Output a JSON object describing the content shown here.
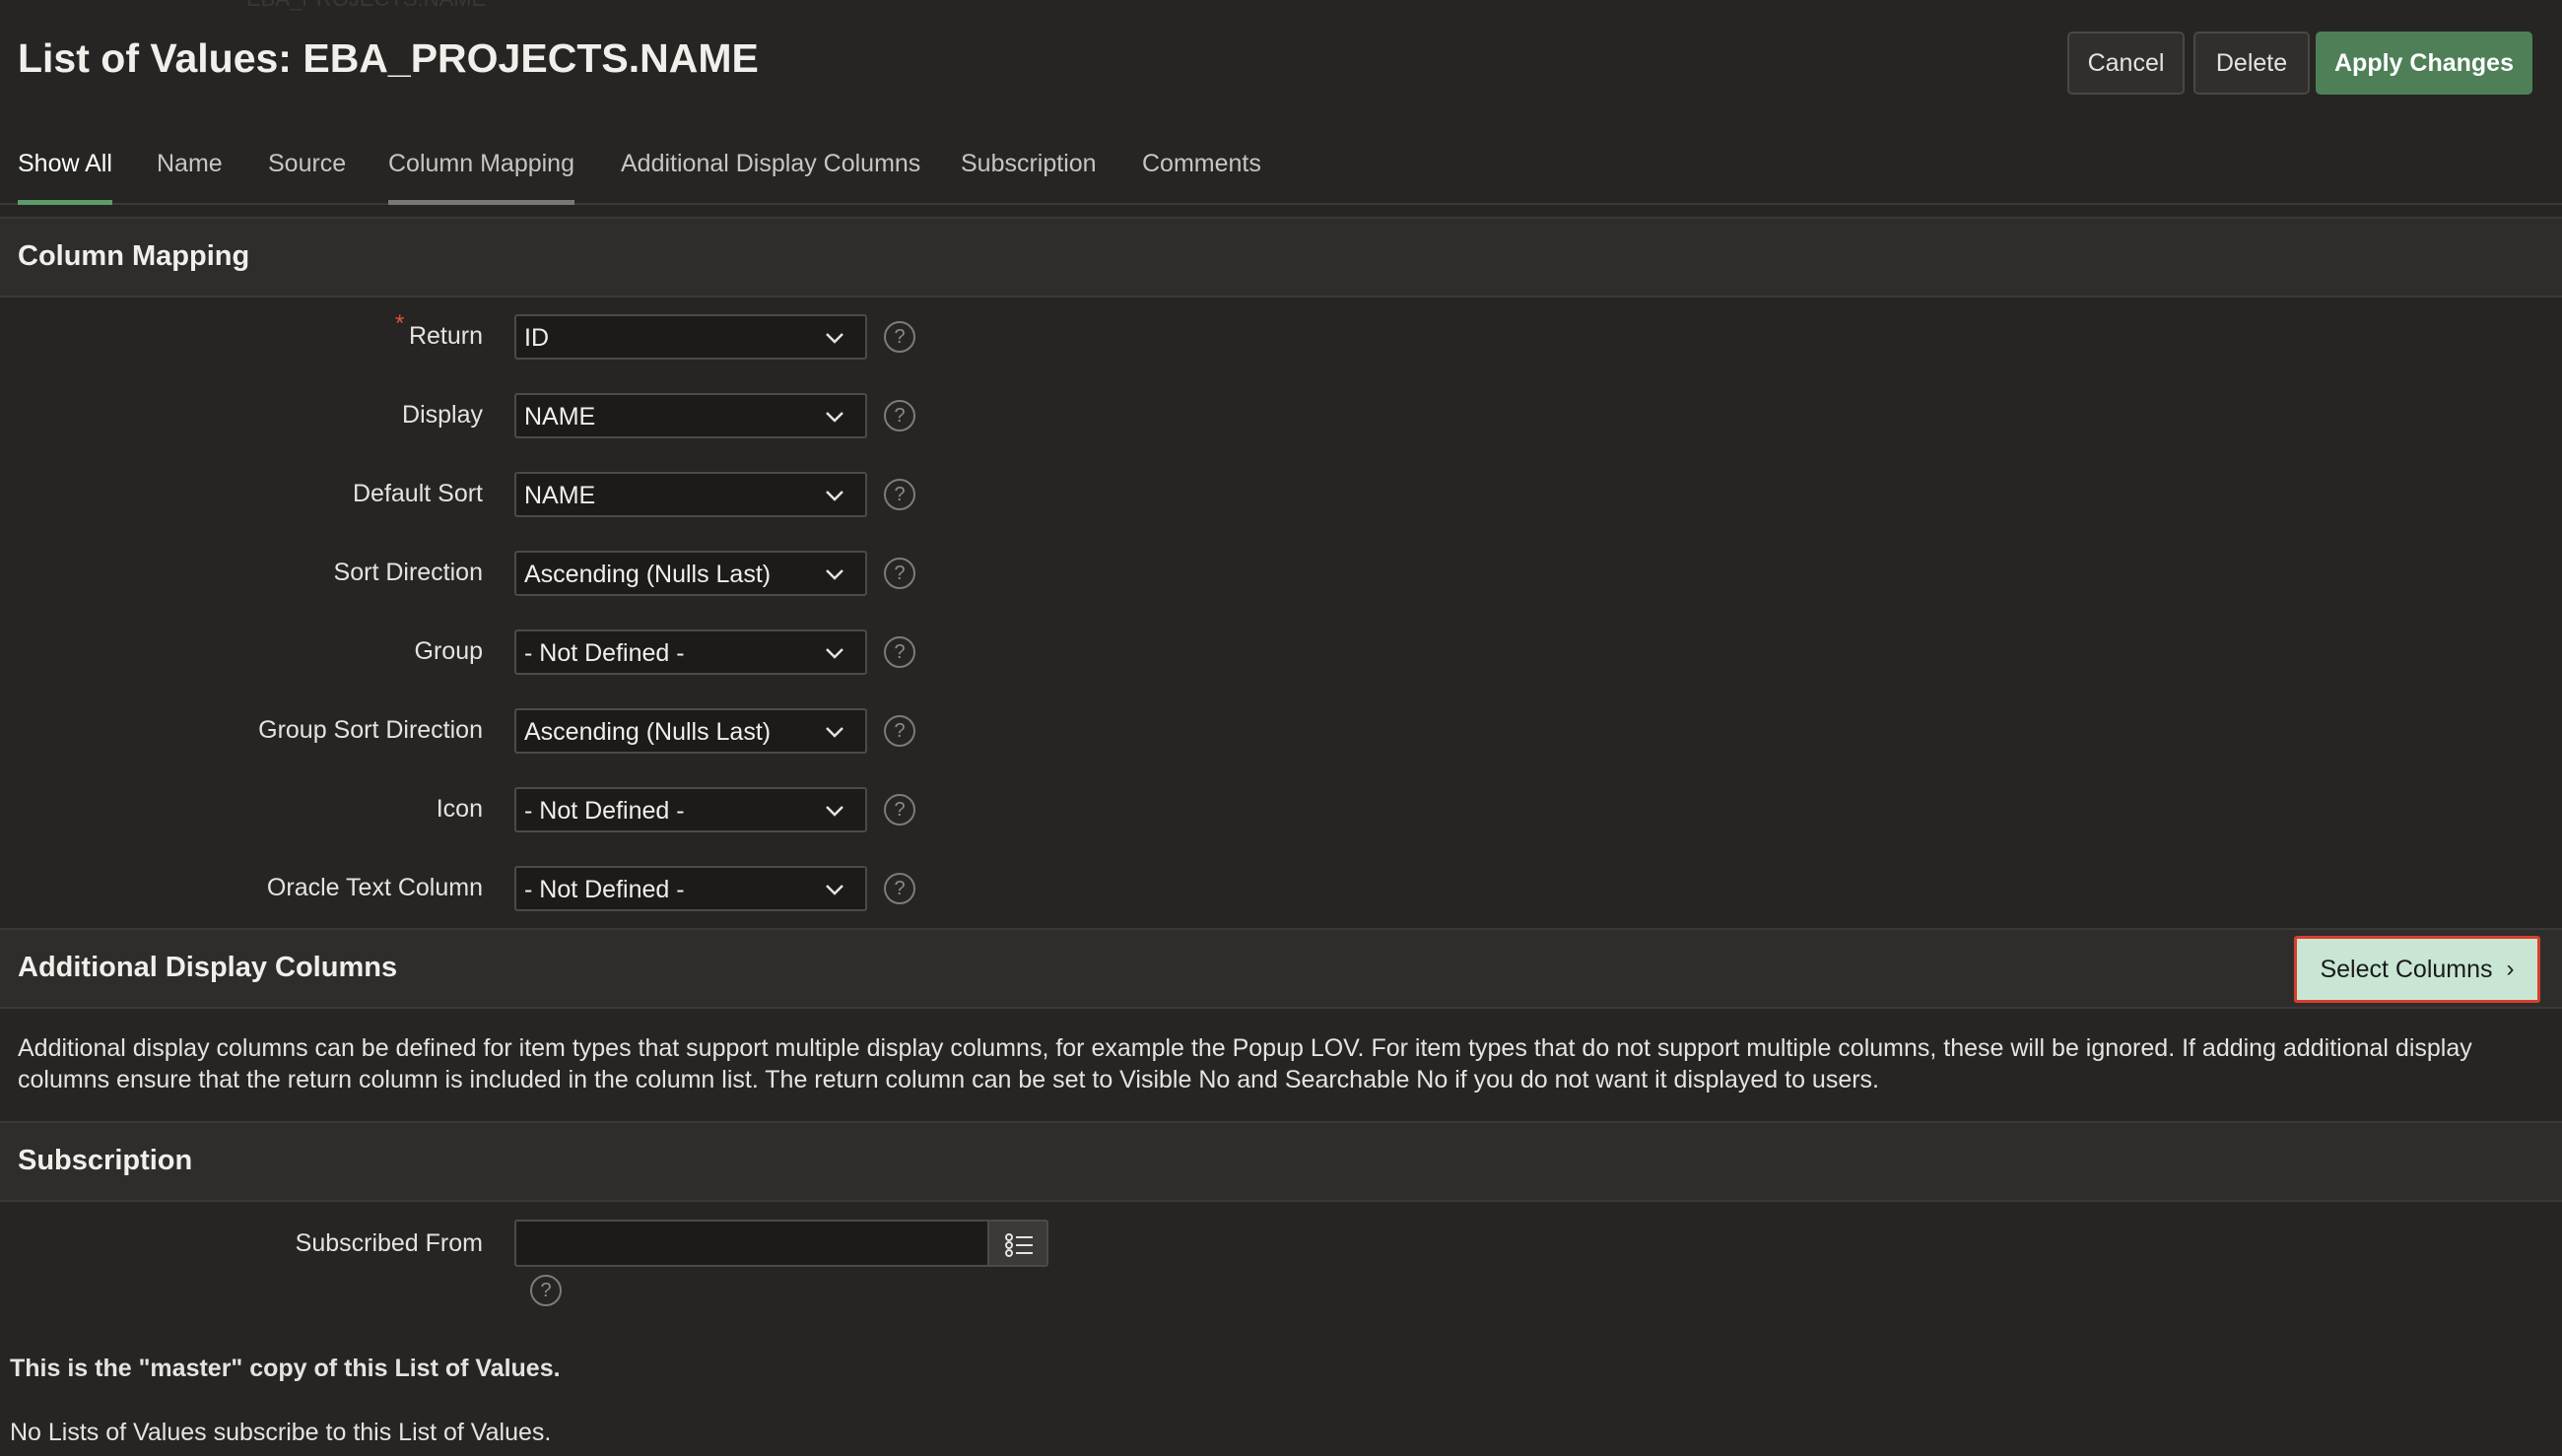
{
  "ghost_breadcrumb": "EBA_PROJECTS.NAME",
  "header": {
    "title": "List of Values: EBA_PROJECTS.NAME",
    "cancel_label": "Cancel",
    "delete_label": "Delete",
    "apply_label": "Apply Changes"
  },
  "tabs": [
    {
      "label": "Show All"
    },
    {
      "label": "Name"
    },
    {
      "label": "Source"
    },
    {
      "label": "Column Mapping"
    },
    {
      "label": "Additional Display Columns"
    },
    {
      "label": "Subscription"
    },
    {
      "label": "Comments"
    }
  ],
  "column_mapping": {
    "title": "Column Mapping",
    "required_mark": "*",
    "fields": [
      {
        "label": "Return",
        "value": "ID"
      },
      {
        "label": "Display",
        "value": "NAME"
      },
      {
        "label": "Default Sort",
        "value": "NAME"
      },
      {
        "label": "Sort Direction",
        "value": "Ascending (Nulls Last)"
      },
      {
        "label": "Group",
        "value": "- Not Defined -"
      },
      {
        "label": "Group Sort Direction",
        "value": "Ascending (Nulls Last)"
      },
      {
        "label": "Icon",
        "value": "- Not Defined -"
      },
      {
        "label": "Oracle Text Column",
        "value": "- Not Defined -"
      }
    ],
    "help_glyph": "?"
  },
  "additional_display": {
    "title": "Additional Display Columns",
    "select_label": "Select Columns",
    "description": "Additional display columns can be defined for item types that support multiple display columns, for example the Popup LOV. For item types that do not support multiple columns, these will be ignored. If adding additional display columns ensure that the return column is included in the column list. The return column can be set to Visible No and Searchable No if you do not want it displayed to users."
  },
  "subscription": {
    "title": "Subscription",
    "subscribed_from_label": "Subscribed From",
    "subscribed_from_value": "",
    "master_note": "This is the \"master\" copy of this List of Values.",
    "subscribers_note": "No Lists of Values subscribe to this List of Values."
  },
  "colors": {
    "background": "#262524",
    "accent_green": "#4e7f57",
    "select_button_bg": "#c8e6d3",
    "highlight_border": "#d6402c"
  }
}
